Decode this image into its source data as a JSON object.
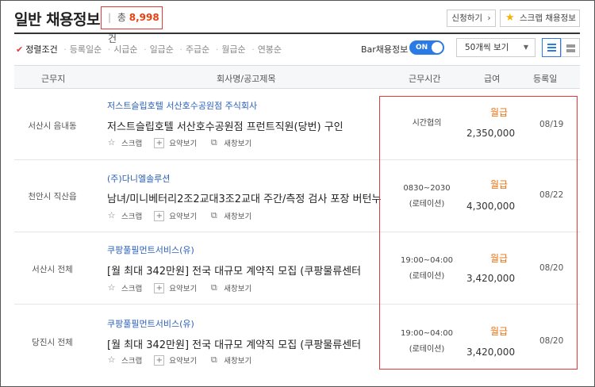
{
  "header": {
    "title": "일반 채용정보",
    "count_prefix": "총",
    "count": "8,998",
    "count_suffix": "건",
    "apply_button": "신청하기",
    "apply_arrow": "›",
    "scrap_button": "스크랩 채용정보"
  },
  "sort": {
    "active": "정렬조건",
    "options": [
      "등록일순",
      "시급순",
      "일급순",
      "주급순",
      "월급순",
      "연봉순"
    ],
    "bar_label": "Bar채용정보",
    "toggle_state": "ON",
    "page_size": "50개씩 보기"
  },
  "table": {
    "headers": {
      "location": "근무지",
      "company": "회사명/공고제목",
      "hours": "근무시간",
      "pay": "급여",
      "date": "등록일"
    },
    "action_labels": {
      "scrap": "스크랩",
      "summary": "요약보기",
      "newwin": "새창보기"
    },
    "rows": [
      {
        "location": "서산시 음내동",
        "company": "저스트슬립호텔 서산호수공원점 주식회사",
        "title": "저스트슬립호텔 서산호수공원점 프런트직원(당번) 구인",
        "hours1": "시간협의",
        "hours2": "",
        "pay_type": "월급",
        "pay_amount": "2,350,000",
        "date": "08/19"
      },
      {
        "location": "천안시 직산읍",
        "company": "(주)다니엘솔루션",
        "title": "남녀/미니베터리2조2교대3조2교대 주간/측정 검사 포장 버턴누",
        "hours1": "0830~2030",
        "hours2": "(로테이션)",
        "pay_type": "월급",
        "pay_amount": "4,300,000",
        "date": "08/22"
      },
      {
        "location": "서산시 전체",
        "company": "쿠팡풀필먼트서비스(유)",
        "title": "[월 최대 342만원] 전국 대규모 계약직 모집 (쿠팡물류센터",
        "hours1": "19:00~04:00",
        "hours2": "(로테이션)",
        "pay_type": "월급",
        "pay_amount": "3,420,000",
        "date": "08/20"
      },
      {
        "location": "당진시 전체",
        "company": "쿠팡풀필먼트서비스(유)",
        "title": "[월 최대 342만원] 전국 대규모 계약직 모집 (쿠팡물류센터",
        "hours1": "19:00~04:00",
        "hours2": "(로테이션)",
        "pay_type": "월급",
        "pay_amount": "3,420,000",
        "date": "08/20"
      }
    ]
  },
  "colors": {
    "accent_blue": "#2a7be4",
    "highlight_red": "#e53935",
    "pay_orange": "#e8700f",
    "company_blue": "#2a5fb8"
  }
}
